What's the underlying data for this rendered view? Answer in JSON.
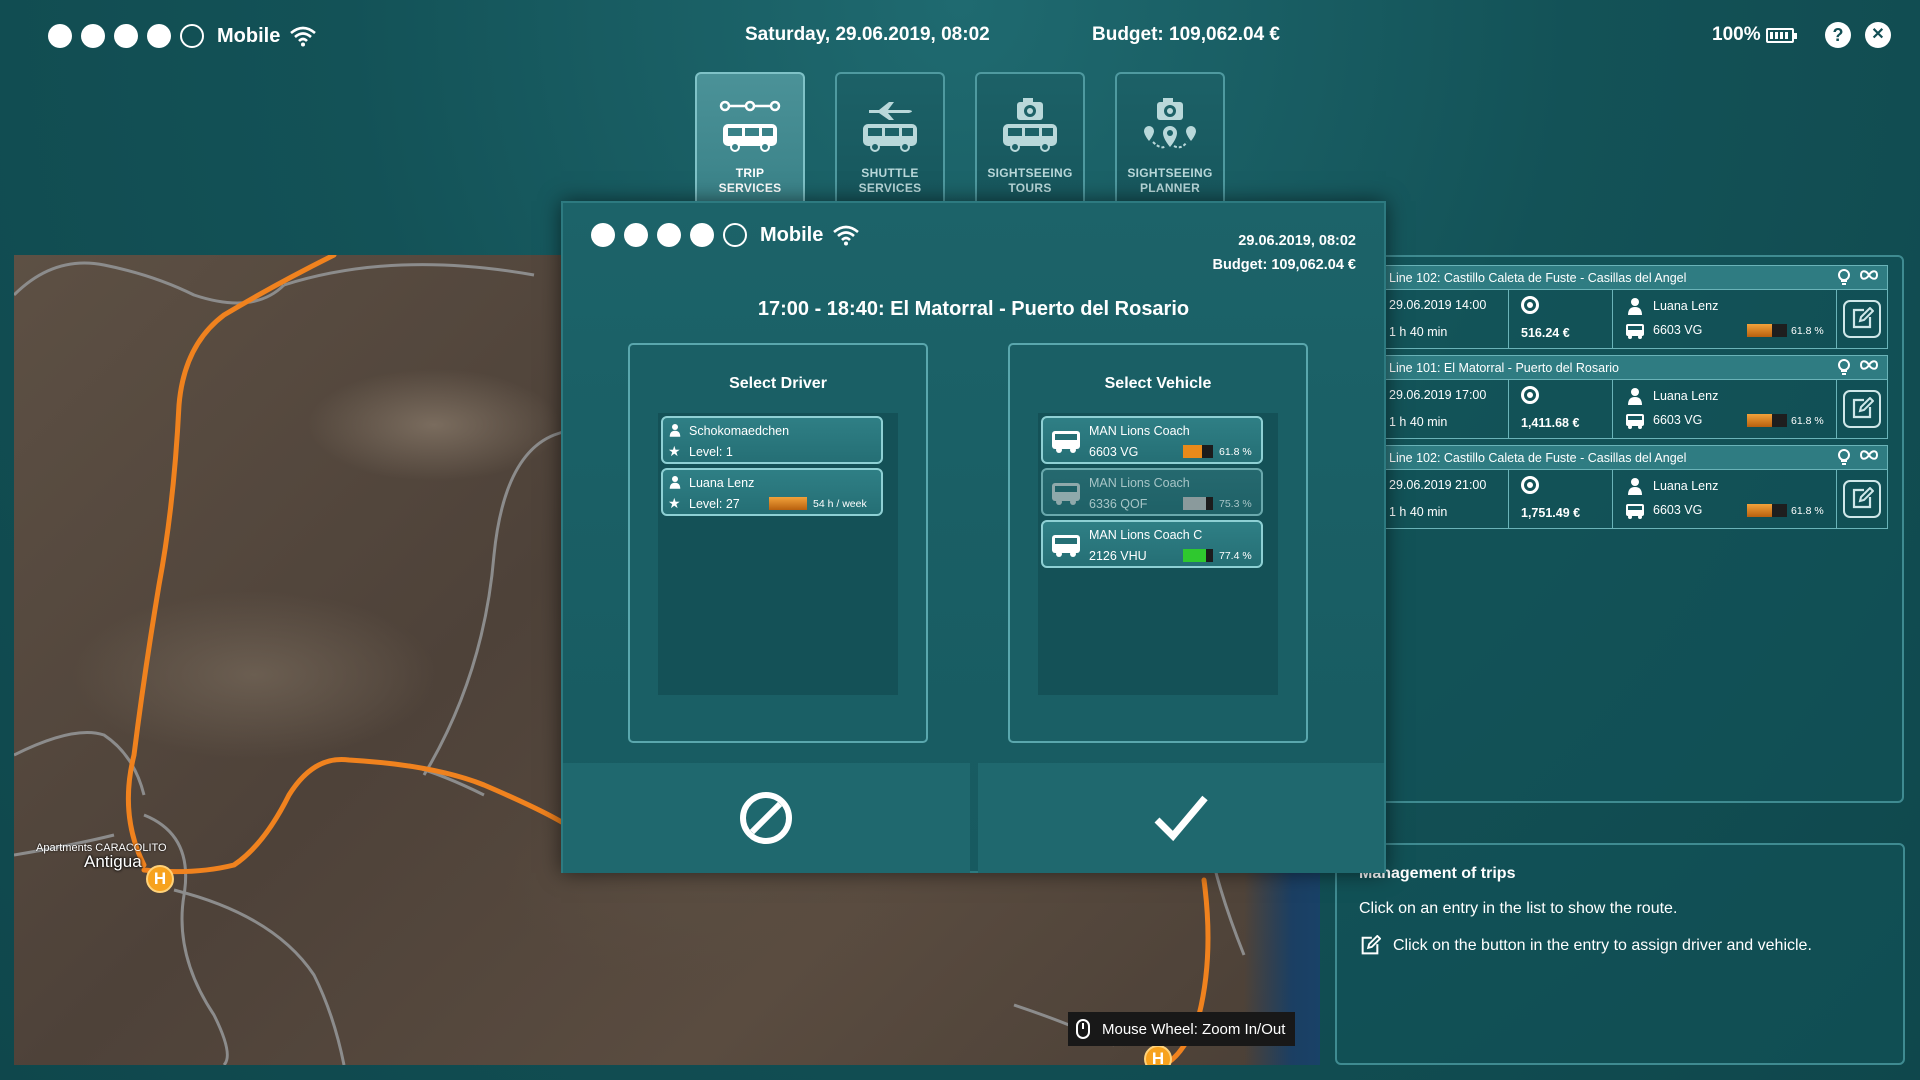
{
  "status_bar": {
    "carrier": "Mobile",
    "datetime": "Saturday, 29.06.2019, 08:02",
    "budget": "Budget: 109,062.04 €",
    "battery": "100%"
  },
  "tabs": [
    {
      "label_line1": "TRIP",
      "label_line2": "SERVICES",
      "active": true,
      "icon": "route-bus-icon"
    },
    {
      "label_line1": "SHUTTLE",
      "label_line2": "SERVICES",
      "active": false,
      "icon": "plane-bus-icon"
    },
    {
      "label_line1": "SIGHTSEEING",
      "label_line2": "TOURS",
      "active": false,
      "icon": "camera-bus-icon"
    },
    {
      "label_line1": "SIGHTSEEING",
      "label_line2": "PLANNER",
      "active": false,
      "icon": "camera-pins-icon"
    }
  ],
  "map": {
    "place_small": "Apartments CARACOLITO",
    "place": "Antigua",
    "hub_letter": "H",
    "hint": "Mouse Wheel: Zoom In/Out"
  },
  "dialog": {
    "carrier": "Mobile",
    "date": "29.06.2019, 08:02",
    "budget": "Budget: 109,062.04 €",
    "title": "17:00 - 18:40: El Matorral - Puerto del Rosario",
    "driver_title": "Select Driver",
    "vehicle_title": "Select Vehicle",
    "drivers": [
      {
        "name": "Schokomaedchen",
        "level": "Level: 1"
      },
      {
        "name": "Luana Lenz",
        "level": "Level: 27",
        "hours": "54 h / week",
        "load": 1.0
      }
    ],
    "vehicles": [
      {
        "model": "MAN Lions Coach",
        "plate": "6603 VG",
        "condition": "61.8 %",
        "value": 0.618,
        "color": "#e88a1a",
        "dim": false
      },
      {
        "model": "MAN Lions Coach",
        "plate": "6336 QOF",
        "condition": "75.3 %",
        "value": 0.753,
        "color": "#8a9a9c",
        "dim": true
      },
      {
        "model": "MAN Lions Coach C",
        "plate": "2126 VHU",
        "condition": "77.4 %",
        "value": 0.774,
        "color": "#2fc82f",
        "dim": false
      }
    ]
  },
  "trips": [
    {
      "line": "Line 102: Castillo Caleta de Fuste - Casillas del Angel",
      "date": "29.06.2019  14:00",
      "duration": "1 h 40 min",
      "cost": "516.24 €",
      "driver": "Luana Lenz",
      "plate": "6603 VG",
      "condition": "61.8 %",
      "value": 0.618
    },
    {
      "line": "Line 101: El Matorral - Puerto del Rosario",
      "date": "29.06.2019  17:00",
      "duration": "1 h 40 min",
      "cost": "1,411.68 €",
      "driver": "Luana Lenz",
      "plate": "6603 VG",
      "condition": "61.8 %",
      "value": 0.618
    },
    {
      "line": "Line 102: Castillo Caleta de Fuste - Casillas del Angel",
      "date": "29.06.2019  21:00",
      "duration": "1 h 40 min",
      "cost": "1,751.49 €",
      "driver": "Luana Lenz",
      "plate": "6603 VG",
      "condition": "61.8 %",
      "value": 0.618
    }
  ],
  "management": {
    "title": "Management of trips",
    "line1": "Click on an entry in the list to show the route.",
    "line2": "Click on the button in the entry to assign driver and vehicle."
  }
}
